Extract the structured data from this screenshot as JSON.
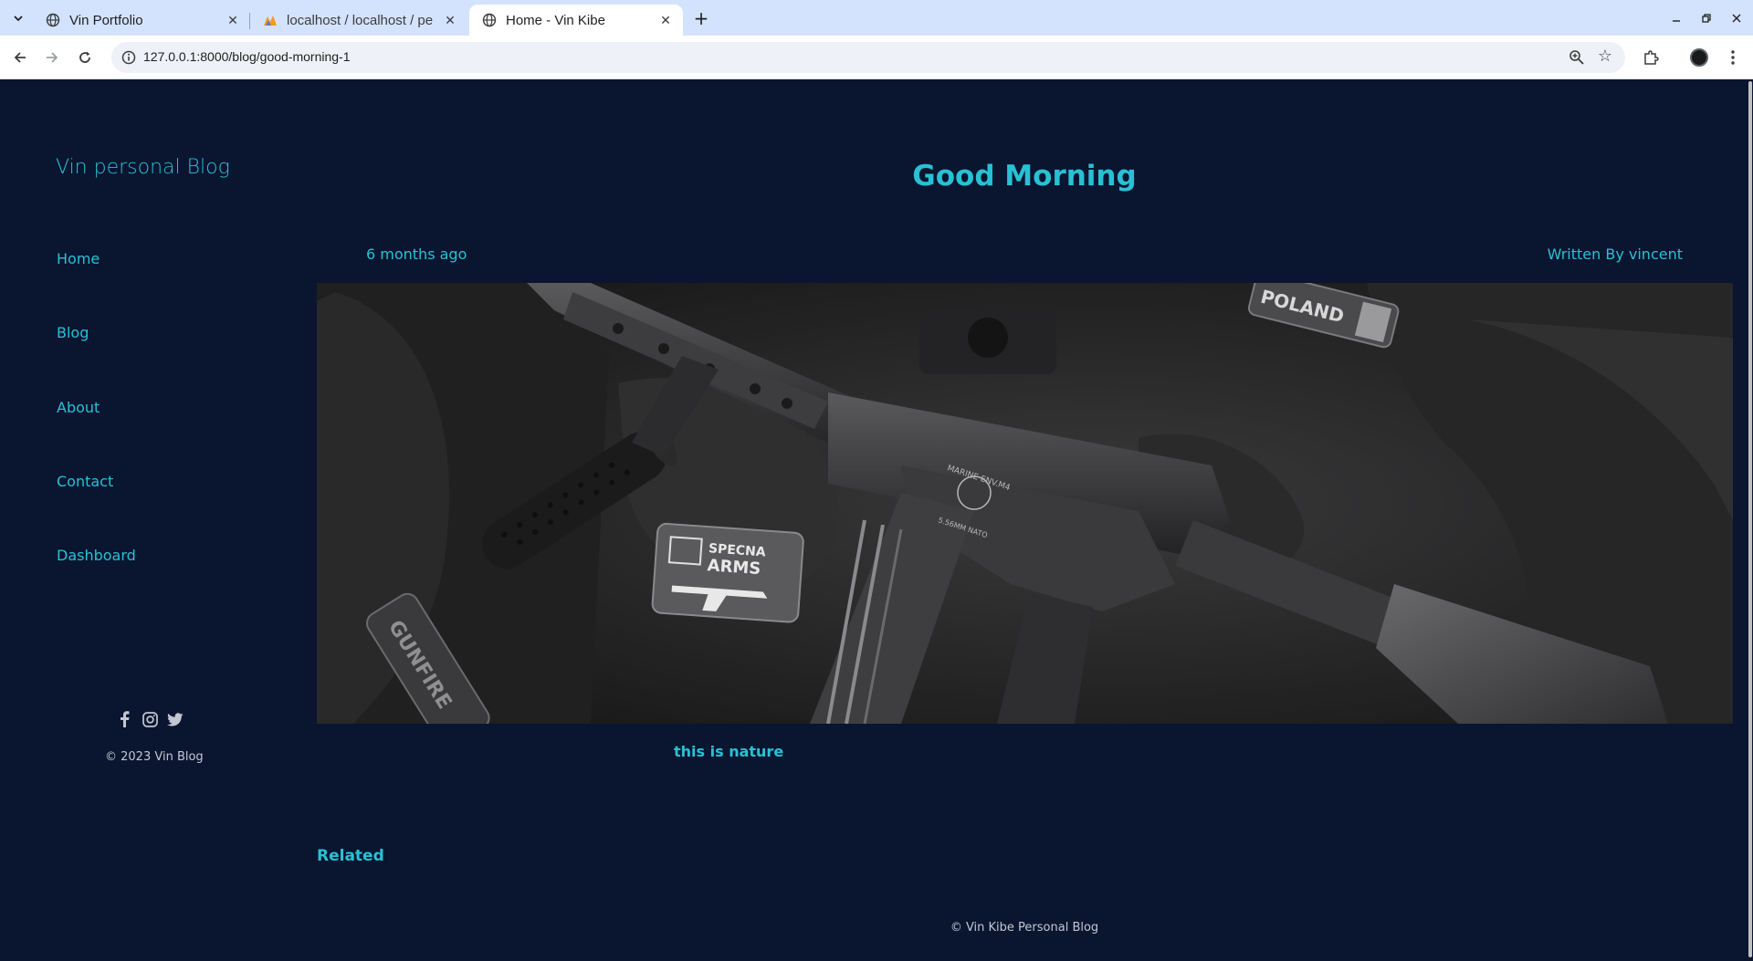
{
  "browser": {
    "tabs": [
      {
        "title": "Vin Portfolio",
        "icon": "globe-icon",
        "active": false
      },
      {
        "title": "localhost / localhost / pe",
        "icon": "phpmyadmin-icon",
        "active": false
      },
      {
        "title": "Home - Vin Kibe",
        "icon": "globe-icon",
        "active": true
      }
    ],
    "url": "127.0.0.1:8000/blog/good-morning-1"
  },
  "sidebar": {
    "blog_title": "Vin personal Blog",
    "nav": [
      {
        "label": "Home"
      },
      {
        "label": "Blog"
      },
      {
        "label": "About"
      },
      {
        "label": "Contact"
      },
      {
        "label": "Dashboard"
      }
    ],
    "social": [
      "facebook-icon",
      "instagram-icon",
      "twitter-icon"
    ],
    "copyright": "© 2023 Vin Blog"
  },
  "post": {
    "title": "Good Morning",
    "date": "6 months ago",
    "author": "Written By vincent",
    "image": {
      "patch_specna_line1": "SPECNA",
      "patch_specna_line2": "ARMS",
      "patch_poland": "POLAND",
      "patch_gunfire": "GUNFIRE",
      "rifle_marking_1": "MARINE ENV.M4",
      "rifle_marking_2": "5.56MM NATO"
    },
    "body": "this is nature"
  },
  "related_heading": "Related",
  "footer": "© Vin Kibe Personal Blog",
  "colors": {
    "accent": "#28c1d4",
    "background": "#0a1530",
    "muted_text": "#c2c7d2"
  }
}
